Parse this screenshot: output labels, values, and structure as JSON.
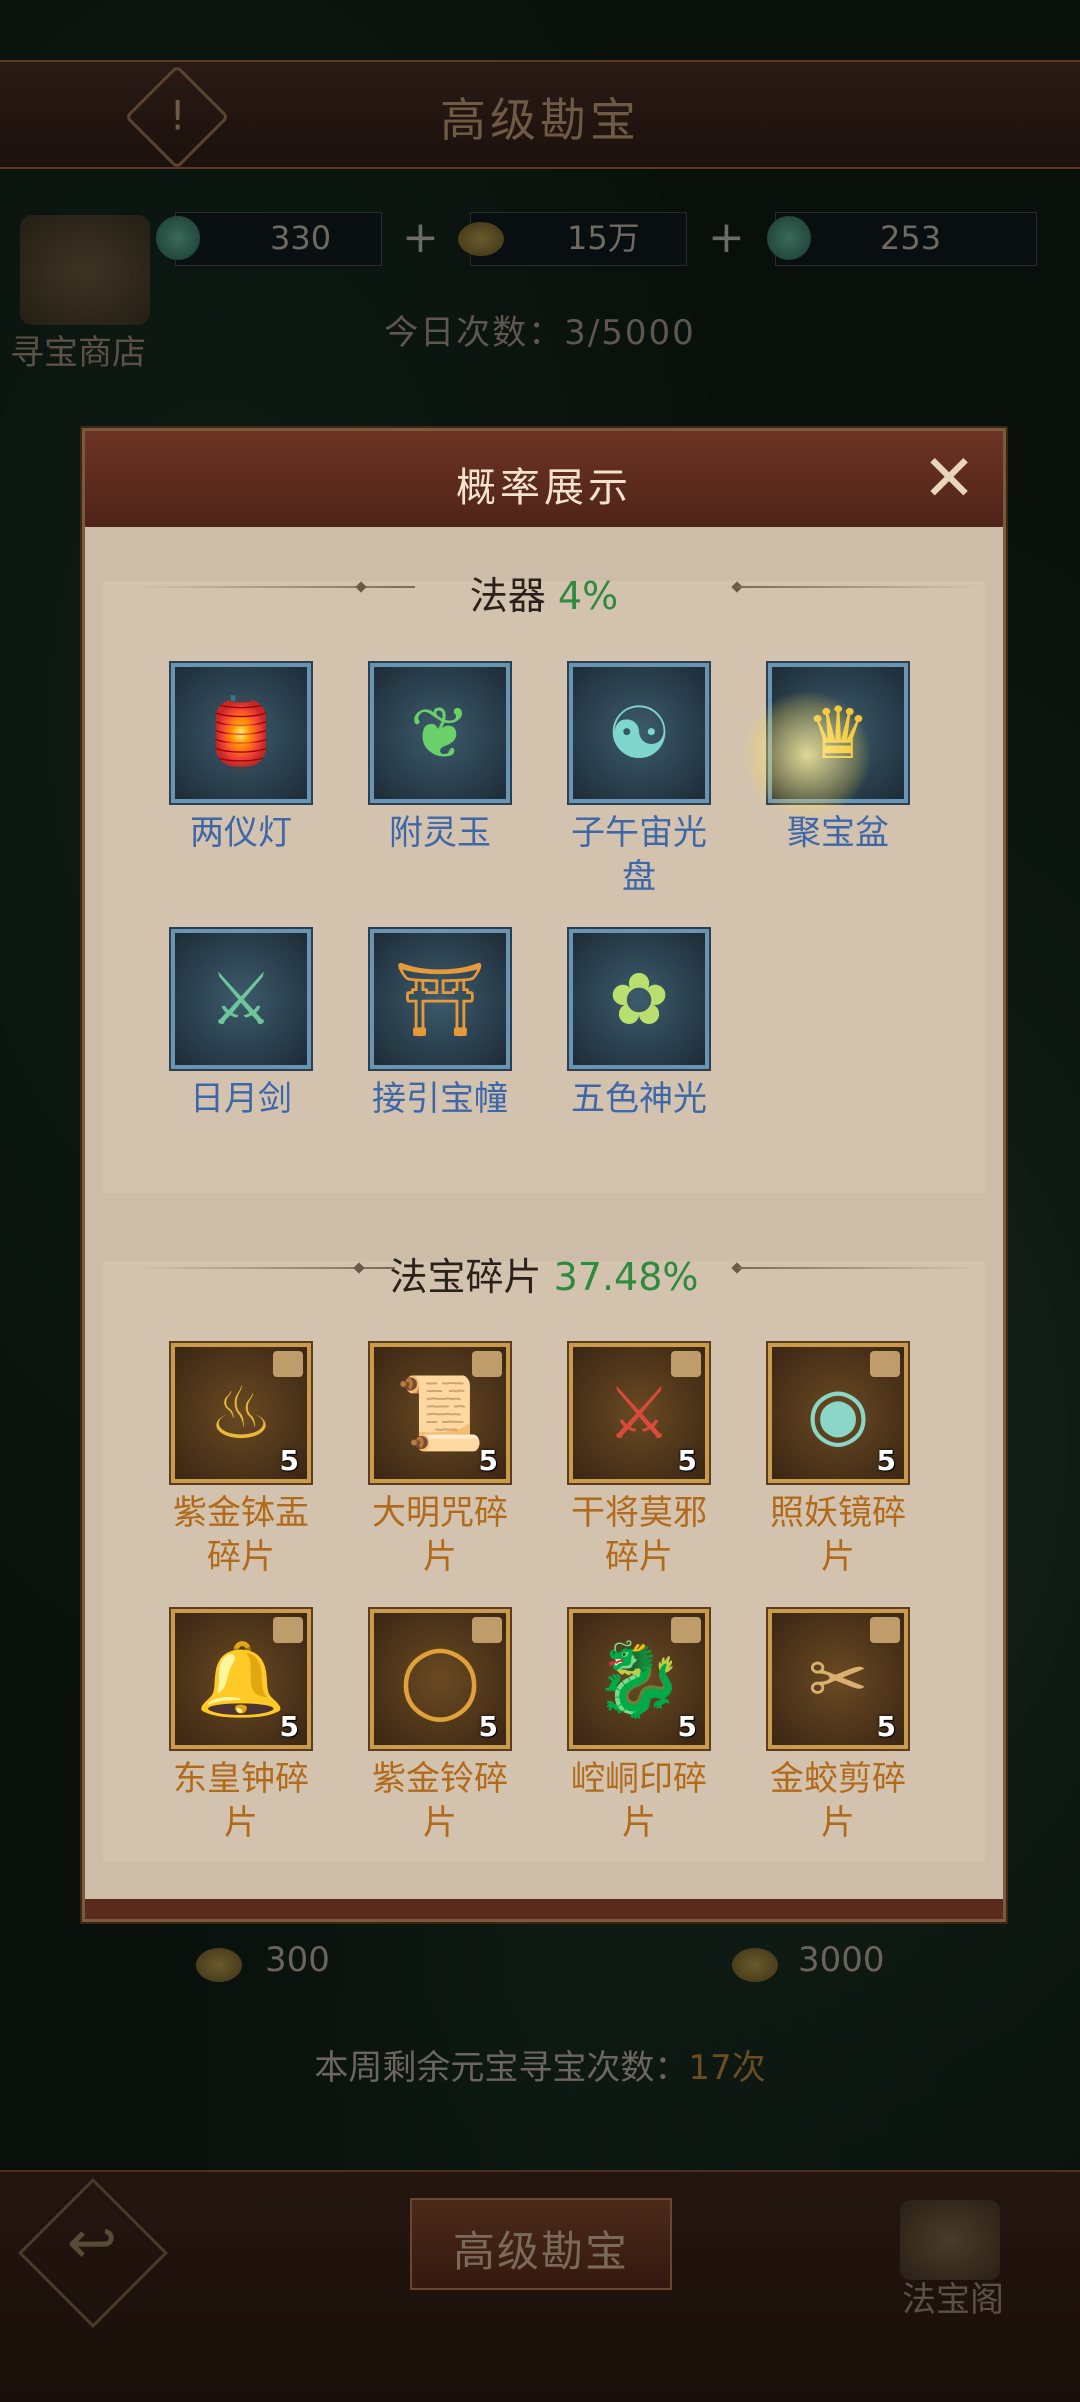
{
  "header": {
    "title": "高级勘宝",
    "alert_glyph": "!"
  },
  "currencies": [
    {
      "icon": "jade-token-icon",
      "value": "330"
    },
    {
      "icon": "gold-ingot-icon",
      "value": "15万"
    },
    {
      "icon": "jade-disc-icon",
      "value": "253"
    }
  ],
  "shop": {
    "label": "寻宝商店"
  },
  "today_count": "今日次数：3/5000",
  "modal": {
    "title": "概率展示",
    "close_glyph": "✕",
    "sections": [
      {
        "label": "法器",
        "percent": "4%",
        "items": [
          {
            "name": "两仪灯",
            "name2": "",
            "icon": "lantern-icon"
          },
          {
            "name": "附灵玉",
            "name2": "",
            "icon": "jade-pendant-icon"
          },
          {
            "name": "子午宙光",
            "name2": "盘",
            "icon": "bagua-disc-icon"
          },
          {
            "name": "聚宝盆",
            "name2": "",
            "icon": "treasure-bowl-icon"
          },
          {
            "name": "日月剑",
            "name2": "",
            "icon": "sword-icon"
          },
          {
            "name": "接引宝幢",
            "name2": "",
            "icon": "pagoda-icon"
          },
          {
            "name": "五色神光",
            "name2": "",
            "icon": "five-lights-icon"
          }
        ]
      },
      {
        "label": "法宝碎片",
        "percent": "37.48%",
        "items": [
          {
            "name": "紫金钵盂",
            "name2": "碎片",
            "count": "5",
            "icon": "alms-bowl-icon"
          },
          {
            "name": "大明咒碎",
            "name2": "片",
            "count": "5",
            "icon": "scroll-tablet-icon"
          },
          {
            "name": "干将莫邪",
            "name2": "碎片",
            "count": "5",
            "icon": "crossed-swords-icon"
          },
          {
            "name": "照妖镜碎",
            "name2": "片",
            "count": "5",
            "icon": "mirror-icon"
          },
          {
            "name": "东皇钟碎",
            "name2": "片",
            "count": "5",
            "icon": "bell-icon"
          },
          {
            "name": "紫金铃碎",
            "name2": "片",
            "count": "5",
            "icon": "ring-bells-icon"
          },
          {
            "name": "崆峒印碎",
            "name2": "片",
            "count": "5",
            "icon": "dragon-seal-icon"
          },
          {
            "name": "金蛟剪碎",
            "name2": "片",
            "count": "5",
            "icon": "scissors-icon"
          }
        ]
      }
    ]
  },
  "costs": {
    "single": "300",
    "multi": "3000"
  },
  "weekly_remaining": {
    "prefix": "本周剩余元宝寻宝次数：",
    "value": "17次"
  },
  "bottom": {
    "main_button": "高级勘宝",
    "pavilion_label": "法宝阁",
    "back_glyph": "↩"
  }
}
